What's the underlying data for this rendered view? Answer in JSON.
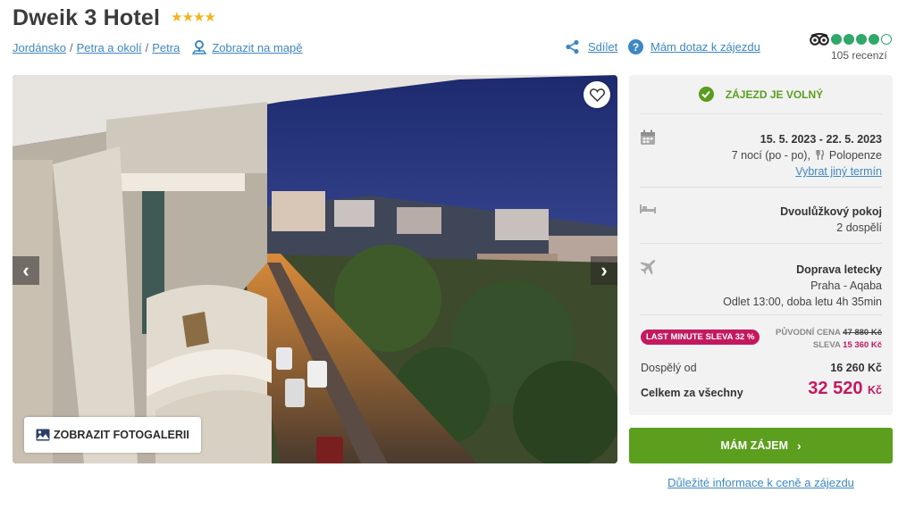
{
  "hotel": {
    "title": "Dweik 3 Hotel",
    "stars": "★★★★"
  },
  "breadcrumbs": {
    "country": "Jordánsko",
    "sep1": "/",
    "region": "Petra a okolí",
    "sep2": "/",
    "city": "Petra",
    "map": "Zobrazit na mapě"
  },
  "actions": {
    "share": "Sdílet",
    "question": "Mám dotaz k zájezdu",
    "question_icon": "?"
  },
  "rating": {
    "reviews": "105 recenzí",
    "score_of_5": 4,
    "brand": "tripadvisor-icon"
  },
  "gallery": {
    "button": "ZOBRAZIT FOTOGALERII",
    "prev": "‹",
    "next": "›"
  },
  "panel": {
    "status": "ZÁJEZD JE VOLNÝ",
    "dates": "15. 5. 2023 - 22. 5. 2023",
    "nights": "7 nocí (po - po),",
    "board": "Polopenze",
    "change_date": "Vybrat jiný termín",
    "room": "Dvoulůžkový pokoj",
    "guests": "2 dospělí",
    "transport": "Doprava letecky",
    "route": "Praha - Aqaba",
    "departure": "Odlet 13:00, doba letu 4h 35min",
    "badge": "LAST MINUTE SLEVA 32 %",
    "orig_label": "PŮVODNÍ CENA",
    "orig_price": "47 880 Kč",
    "discount_label": "SLEVA",
    "discount_value": "15 360 Kč",
    "adult_label": "Dospělý od",
    "adult_price": "16 260 Kč",
    "total_label": "Celkem za všechny",
    "total_amount": "32 520",
    "total_currency": "Kč"
  },
  "cta": {
    "label": "MÁM ZÁJEM",
    "chevron": "›"
  },
  "info_link": "Důležité informace k ceně a zájezdu",
  "colors": {
    "link": "#3d87c4",
    "green": "#5c9e1e",
    "accent": "#c4195f",
    "panel": "#f2f2f2"
  }
}
